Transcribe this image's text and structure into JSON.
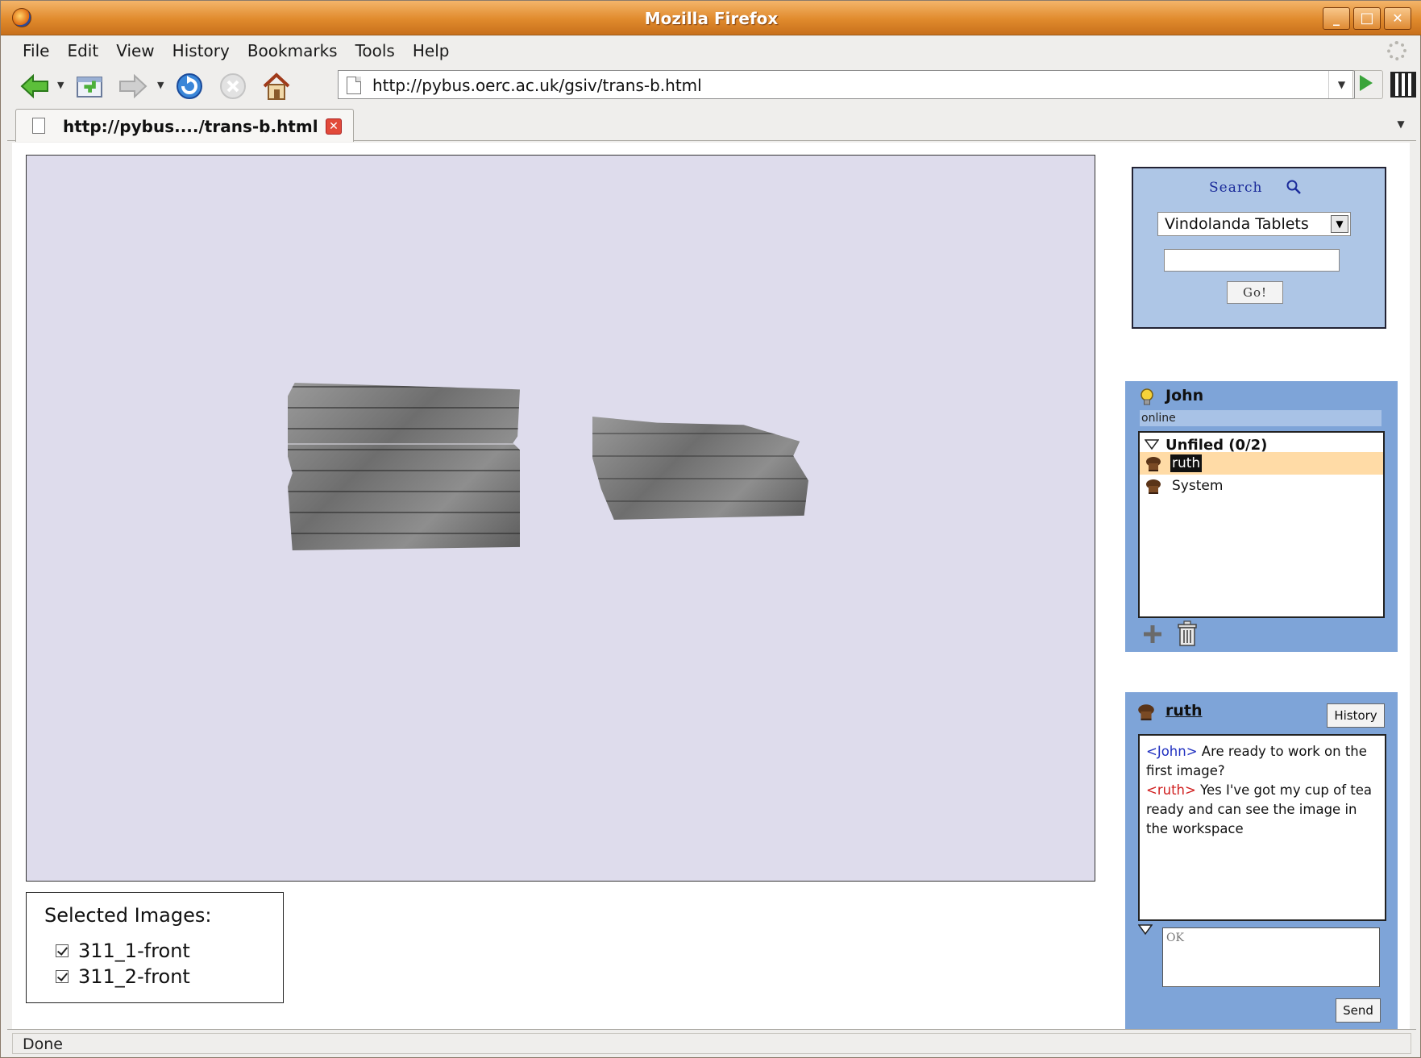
{
  "window": {
    "title": "Mozilla Firefox",
    "controls": {
      "minimize": "_",
      "maximize": "□",
      "close": "✕"
    }
  },
  "menubar": {
    "items": [
      "File",
      "Edit",
      "View",
      "History",
      "Bookmarks",
      "Tools",
      "Help"
    ]
  },
  "navbar": {
    "url": "http://pybus.oerc.ac.uk/gsiv/trans-b.html",
    "icons": [
      "back-icon",
      "new-tab-icon",
      "forward-icon",
      "reload-icon",
      "stop-icon",
      "home-icon"
    ]
  },
  "tabs": [
    {
      "label": "http://pybus..../trans-b.html"
    }
  ],
  "workspace": {
    "background": "#dedcec",
    "images": [
      "tablet-311_1-front",
      "tablet-311_2-front"
    ]
  },
  "selected_images": {
    "title": "Selected Images:",
    "items": [
      {
        "label": "311_1-front",
        "checked": true
      },
      {
        "label": "311_2-front",
        "checked": true
      }
    ]
  },
  "search": {
    "title": "Search",
    "collection": "Vindolanda Tablets",
    "query": "",
    "go_label": "Go!"
  },
  "buddy": {
    "name": "John",
    "status": "online",
    "group": "Unfiled (0/2)",
    "contacts": [
      {
        "name": "ruth",
        "selected": true
      },
      {
        "name": "System",
        "selected": false
      }
    ],
    "panel_color": "#7ea4d8"
  },
  "chat": {
    "contact": "ruth",
    "history_label": "History",
    "messages": [
      {
        "nick": "<John>",
        "text": " Are ready to work on the first image?",
        "nick_color": "#2030c0"
      },
      {
        "nick": "<ruth>",
        "text": " Yes I've got my cup of tea ready and can see the image in the workspace",
        "nick_color": "#d02020"
      }
    ],
    "input_value": "OK",
    "send_label": "Send"
  },
  "statusbar": {
    "text": "Done"
  }
}
